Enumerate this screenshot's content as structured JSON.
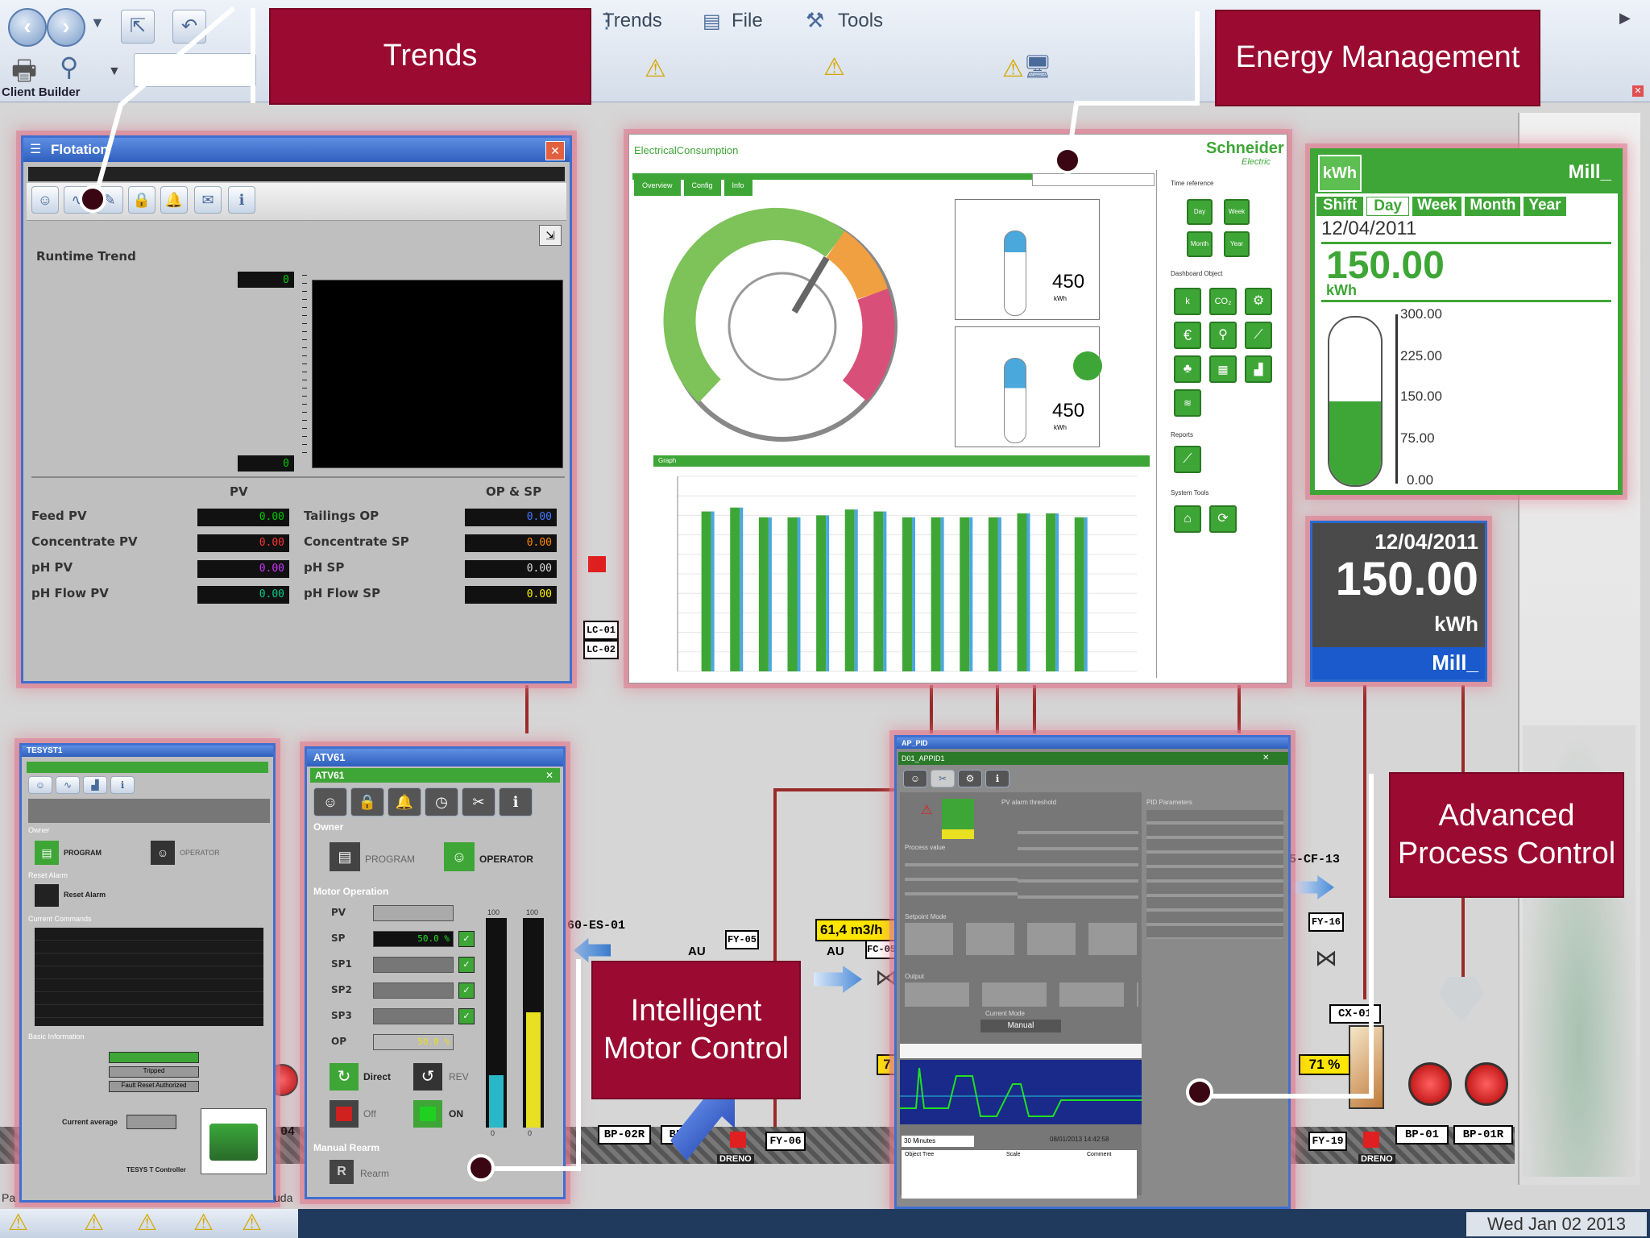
{
  "toolbar": {
    "menu_trends": "Trends",
    "menu_file": "File",
    "menu_tools": "Tools",
    "client_builder": "Client Builder"
  },
  "callouts": {
    "trends": "Trends",
    "energy": "Energy Management",
    "imc": "Intelligent Motor Control",
    "apc": "Advanced Process Control"
  },
  "flotation": {
    "title": "Flotation",
    "runtime_trend": "Runtime Trend",
    "top_value": "0",
    "bottom_value": "0",
    "pv_header": "PV",
    "opsp_header": "OP & SP",
    "rows_left": [
      {
        "label": "Feed PV",
        "value": "0.00",
        "color": "#00cc00"
      },
      {
        "label": "Concentrate PV",
        "value": "0.00",
        "color": "#ff3333"
      },
      {
        "label": "pH PV",
        "value": "0.00",
        "color": "#cc33ff"
      },
      {
        "label": "pH Flow PV",
        "value": "0.00",
        "color": "#00cc88"
      }
    ],
    "rows_right": [
      {
        "label": "Tailings OP",
        "value": "0.00",
        "color": "#4477ff"
      },
      {
        "label": "Concentrate SP",
        "value": "0.00",
        "color": "#ff8800"
      },
      {
        "label": "pH SP",
        "value": "0.00",
        "color": "#dddddd"
      },
      {
        "label": "pH Flow SP",
        "value": "0.00",
        "color": "#ffee00"
      }
    ]
  },
  "energy": {
    "title": "ElectricalConsumption",
    "brand": "Schneider",
    "brand_sub": "Electric",
    "tabs": [
      "Overview",
      "Config",
      "Info"
    ],
    "value1": "450",
    "unit1": "kWh",
    "value2": "450",
    "unit2": "kWh",
    "graph_label": "Graph",
    "time_reference": "Time reference",
    "dashboard_object": "Dashboard Object",
    "reports": "Reports",
    "system_tools": "System Tools",
    "time_buttons": [
      "Day",
      "Week",
      "Month",
      "Year"
    ],
    "chart_data": {
      "type": "bar",
      "values": [
        82,
        84,
        79,
        79,
        80,
        83,
        82,
        79,
        79,
        79,
        79,
        81,
        81,
        79
      ],
      "ylim": [
        0,
        100
      ]
    }
  },
  "kwh_green": {
    "unit_badge": "kWh",
    "name": "Mill_",
    "tabs": [
      "Shift",
      "Day",
      "Week",
      "Month",
      "Year"
    ],
    "date": "12/04/2011",
    "value": "150.00",
    "unit": "kWh",
    "scale": [
      "300.00",
      "225.00",
      "150.00",
      "75.00",
      "0.00"
    ],
    "level_fraction": 0.5
  },
  "kwh_blue": {
    "date": "12/04/2011",
    "value": "150.00",
    "unit": "kWh",
    "name": "Mill_"
  },
  "tesys": {
    "title": "TESYST1",
    "owner": "Owner",
    "program": "PROGRAM",
    "operator": "OPERATOR",
    "reset_alarm_label": "Reset Alarm",
    "reset_alarm_btn": "Reset Alarm",
    "current_commands": "Current Commands",
    "basic_info": "Basic Information",
    "tripped": "Tripped",
    "fault_reset": "Fault Reset Authorized",
    "current_average": "Current average",
    "controller": "TESYS T Controller"
  },
  "atv": {
    "title": "ATV61",
    "subtitle": "ATV61",
    "owner": "Owner",
    "program": "PROGRAM",
    "operator": "OPERATOR",
    "motor_operation": "Motor Operation",
    "rows": [
      "PV",
      "SP",
      "SP1",
      "SP2",
      "SP3",
      "OP"
    ],
    "sp_value": "50.0 %",
    "op_value": "50.0 %",
    "direct": "Direct",
    "rev": "REV",
    "off": "Off",
    "on": "ON",
    "manual_rearm": "Manual Rearm",
    "rearm": "Rearm",
    "bar_top1": "100",
    "bar_top2": "100",
    "bar_bot1": "0",
    "bar_bot2": "0",
    "bar1_fraction": 0.25,
    "bar2_fraction": 0.55
  },
  "apc": {
    "title": "AP_PID",
    "subtitle": "D01_APPID1",
    "manual": "Manual",
    "pv_alarm": "PV alarm threshold",
    "pid_params": "PID Parameters",
    "process_value": "Process value",
    "setpoint_mode": "Setpoint Mode",
    "output": "Output",
    "current_mode": "Current Mode",
    "time_window": "30 Minutes",
    "timestamp": "08/01/2013 14:42:58",
    "object_tree": "Object Tree",
    "scale": "Scale",
    "comment": "Comment"
  },
  "process": {
    "tags": [
      "LC-01",
      "LC-02",
      "60-ES-01",
      "FY-05",
      "FC-05",
      "5-CF-13",
      "FY-16",
      "CX-01",
      "BP-02R",
      "BP",
      "FY-06",
      "FY-19",
      "BP-01",
      "BP-01R",
      "DRENO",
      "DRENO"
    ],
    "flow_value": "61,4 m3/h",
    "au1": "AU",
    "au2": "AU",
    "pct": "71 %",
    "pct_prefix": "7",
    "left_num": "04"
  },
  "status": {
    "datetime": "Wed Jan 02 2013",
    "pa": "Pa",
    "uda": "uda"
  }
}
